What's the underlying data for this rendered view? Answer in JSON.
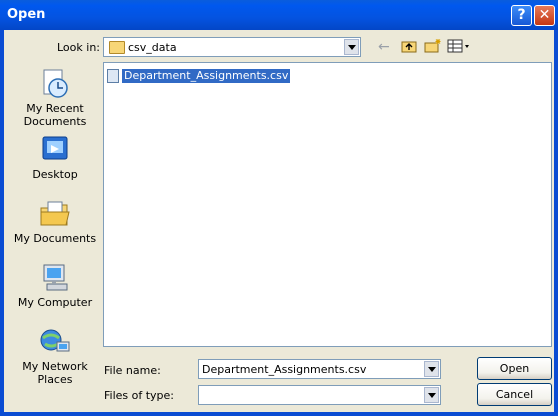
{
  "window": {
    "title": "Open"
  },
  "titlebar": {
    "help_glyph": "?",
    "close_glyph": "✕"
  },
  "look_in": {
    "label": "Look in:",
    "value": "csv_data"
  },
  "places": [
    {
      "label_line1": "My Recent",
      "label_line2": "Documents",
      "icon": "recent-documents-icon"
    },
    {
      "label_line1": "Desktop",
      "label_line2": "",
      "icon": "desktop-icon"
    },
    {
      "label_line1": "My Documents",
      "label_line2": "",
      "icon": "my-documents-icon"
    },
    {
      "label_line1": "My Computer",
      "label_line2": "",
      "icon": "my-computer-icon"
    },
    {
      "label_line1": "My Network",
      "label_line2": "Places",
      "icon": "network-places-icon"
    }
  ],
  "files": [
    {
      "name": "Department_Assignments.csv",
      "selected": true
    }
  ],
  "file_name": {
    "label": "File name:",
    "value": "Department_Assignments.csv"
  },
  "files_of_type": {
    "label": "Files of type:",
    "value": ""
  },
  "buttons": {
    "open": "Open",
    "cancel": "Cancel"
  },
  "colors": {
    "titlebar": "#0058ee",
    "selection": "#316ac5",
    "dialog_bg": "#ece9d8"
  }
}
